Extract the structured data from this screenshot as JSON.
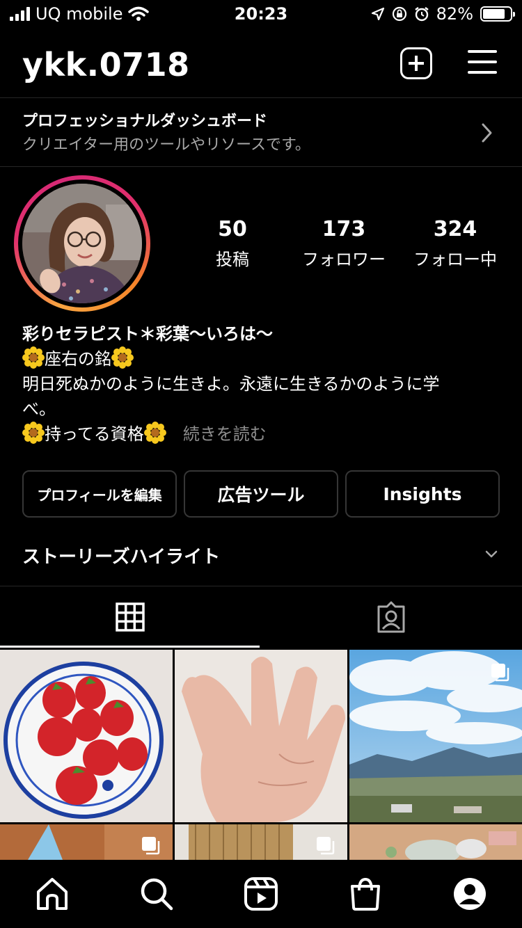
{
  "status_bar": {
    "carrier": "UQ mobile",
    "time": "20:23",
    "battery": "82%",
    "battery_level": 0.82
  },
  "header": {
    "username": "ykk.0718"
  },
  "dashboard": {
    "title": "プロフェッショナルダッシュボード",
    "subtitle": "クリエイター用のツールやリソースです。"
  },
  "stats": [
    {
      "value": "50",
      "label": "投稿"
    },
    {
      "value": "173",
      "label": "フォロワー"
    },
    {
      "value": "324",
      "label": "フォロー中"
    }
  ],
  "bio": {
    "name": "彩りセラピスト＊彩葉〜いろは〜",
    "line1": "座右の銘",
    "line2": "明日死ぬかのように生きよ。永遠に生きるかのように学",
    "line3": "べ。",
    "line4": "持ってる資格",
    "more": "続きを読む"
  },
  "buttons": {
    "edit_profile": "プロフィールを編集",
    "ad_tools": "広告ツール",
    "insights": "Insights"
  },
  "highlights": {
    "label": "ストーリーズハイライト"
  },
  "colors": {
    "background": "#000000",
    "secondary_text": "#a8a8a8",
    "border": "#363636",
    "ring_start": "#f9a541",
    "ring_end": "#e1306c"
  }
}
